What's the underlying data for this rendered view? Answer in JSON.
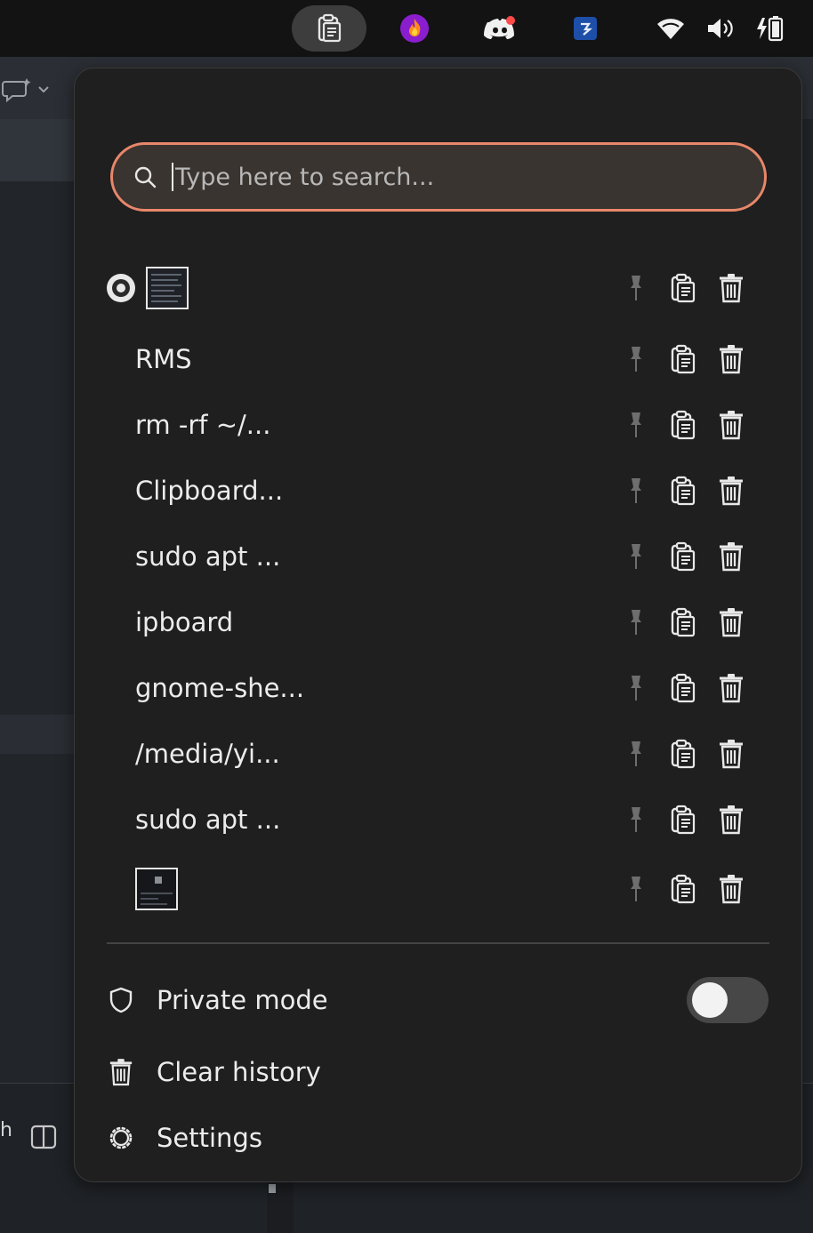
{
  "search": {
    "placeholder": "Type here to search..."
  },
  "clipboard_items": [
    {
      "type": "image",
      "label": "",
      "selected": true
    },
    {
      "type": "text",
      "label": "RMS"
    },
    {
      "type": "text",
      "label": "rm -rf ~/..."
    },
    {
      "type": "text",
      "label": "Clipboard..."
    },
    {
      "type": "text",
      "label": "sudo apt ..."
    },
    {
      "type": "text",
      "label": "ipboard"
    },
    {
      "type": "text",
      "label": "gnome-she..."
    },
    {
      "type": "text",
      "label": "/media/yi..."
    },
    {
      "type": "text",
      "label": "sudo apt ..."
    },
    {
      "type": "image",
      "label": ""
    }
  ],
  "item_actions": [
    "pin-icon",
    "copy-icon",
    "delete-icon"
  ],
  "menu": {
    "private_mode": {
      "label": "Private mode",
      "enabled": false
    },
    "clear_history": {
      "label": "Clear history"
    },
    "settings": {
      "label": "Settings"
    }
  },
  "background": {
    "partial_text": "h"
  },
  "colors": {
    "accent": "#e8876a",
    "popup_bg": "#1f1f1f",
    "topbar_bg": "#131313",
    "text": "#ececec"
  }
}
